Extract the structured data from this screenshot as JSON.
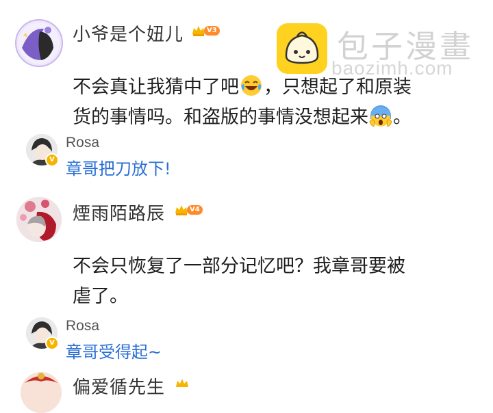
{
  "watermark": {
    "title": "包子漫畫",
    "url": "baozimh.com"
  },
  "comments": [
    {
      "username": "小爷是个妞儿",
      "level": "V3",
      "text_line1": "不会真让我猜中了吧",
      "text_line1_after": "，只想起了和原装",
      "text_line2": "货的事情吗。和盗版的事情没想起来",
      "text_line2_after": "。",
      "reply": {
        "author": "Rosa",
        "text": "章哥把刀放下!"
      }
    },
    {
      "username": "煙雨陌路辰",
      "level": "V4",
      "text_line1": "不会只恢复了一部分记忆吧？我章哥要被",
      "text_line2": "虐了。",
      "reply": {
        "author": "Rosa",
        "text": "章哥受得起~"
      }
    },
    {
      "username": "偏爱循先生"
    }
  ],
  "colors": {
    "reply_text": "#2a6fd6",
    "level_badge": "#ff8a2a",
    "crown": "#f7b500"
  },
  "icons": [
    "crown-icon",
    "laughing-tears-emoji",
    "screaming-fear-emoji",
    "verified-v-icon"
  ]
}
